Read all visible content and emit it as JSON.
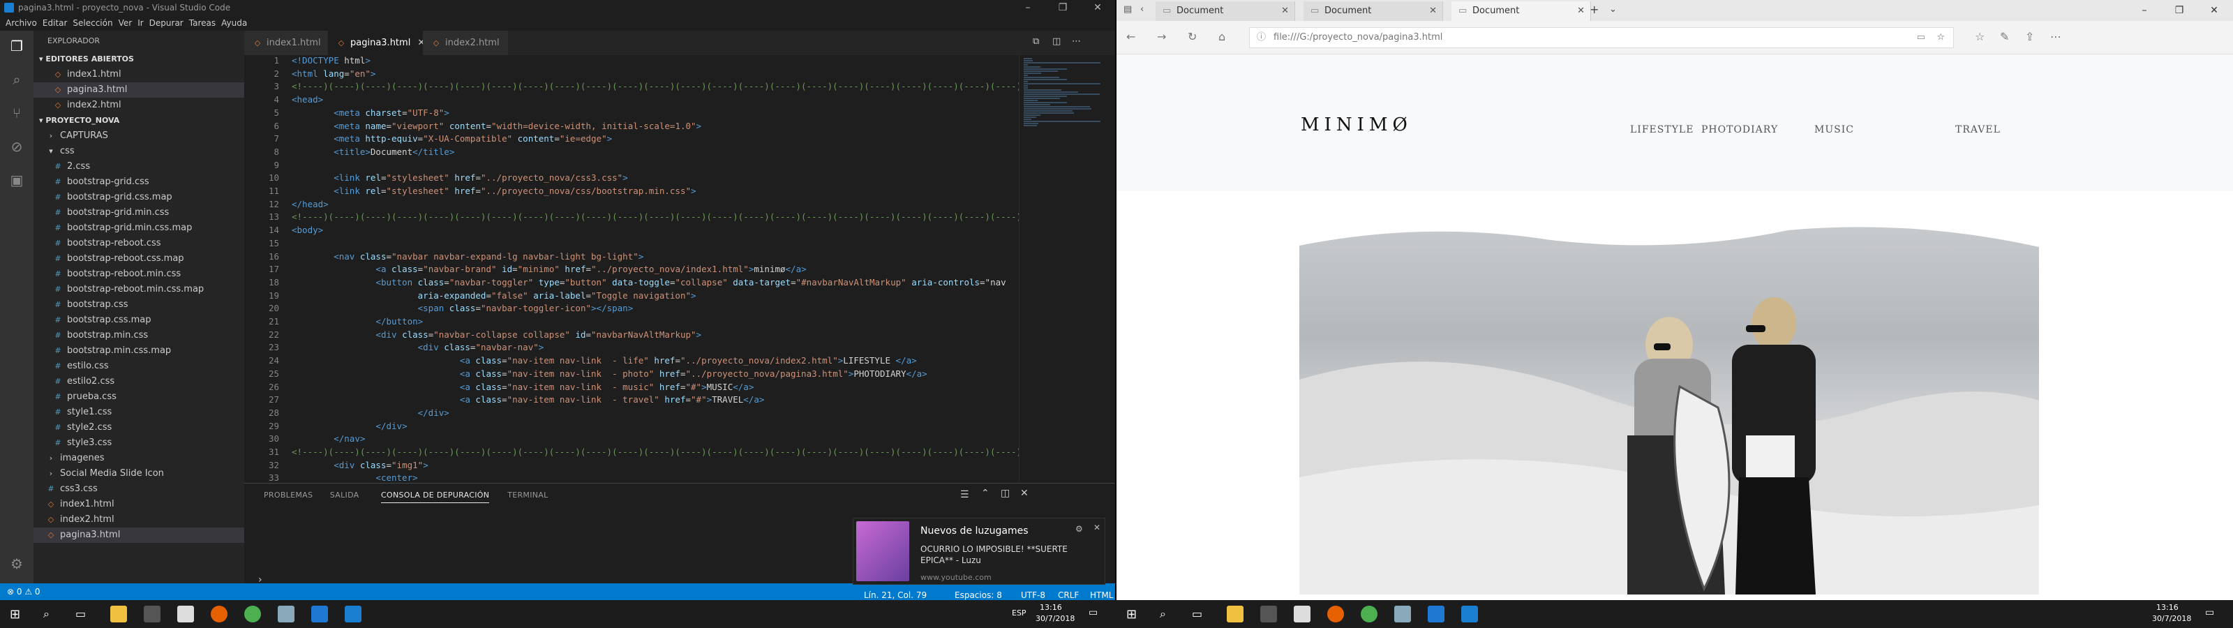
{
  "vscode": {
    "title": "pagina3.html - proyecto_nova - Visual Studio Code",
    "menu": [
      "Archivo",
      "Editar",
      "Selección",
      "Ver",
      "Ir",
      "Depurar",
      "Tareas",
      "Ayuda"
    ],
    "explorer_title": "EXPLORADOR",
    "open_editors_label": "EDITORES ABIERTOS",
    "open_editors": [
      "index1.html",
      "pagina3.html",
      "index2.html"
    ],
    "project_label": "PROYECTO_NOVA",
    "tree": [
      {
        "name": "CAPTURAS",
        "kind": "dir",
        "indent": 1,
        "open": false
      },
      {
        "name": "css",
        "kind": "dir",
        "indent": 1,
        "open": true
      },
      {
        "name": "2.css",
        "kind": "css",
        "indent": 2
      },
      {
        "name": "bootstrap-grid.css",
        "kind": "css",
        "indent": 2
      },
      {
        "name": "bootstrap-grid.css.map",
        "kind": "css",
        "indent": 2
      },
      {
        "name": "bootstrap-grid.min.css",
        "kind": "css",
        "indent": 2
      },
      {
        "name": "bootstrap-grid.min.css.map",
        "kind": "css",
        "indent": 2
      },
      {
        "name": "bootstrap-reboot.css",
        "kind": "css",
        "indent": 2
      },
      {
        "name": "bootstrap-reboot.css.map",
        "kind": "css",
        "indent": 2
      },
      {
        "name": "bootstrap-reboot.min.css",
        "kind": "css",
        "indent": 2
      },
      {
        "name": "bootstrap-reboot.min.css.map",
        "kind": "css",
        "indent": 2
      },
      {
        "name": "bootstrap.css",
        "kind": "css",
        "indent": 2
      },
      {
        "name": "bootstrap.css.map",
        "kind": "css",
        "indent": 2
      },
      {
        "name": "bootstrap.min.css",
        "kind": "css",
        "indent": 2
      },
      {
        "name": "bootstrap.min.css.map",
        "kind": "css",
        "indent": 2
      },
      {
        "name": "estilo.css",
        "kind": "css",
        "indent": 2
      },
      {
        "name": "estilo2.css",
        "kind": "css",
        "indent": 2
      },
      {
        "name": "prueba.css",
        "kind": "css",
        "indent": 2
      },
      {
        "name": "style1.css",
        "kind": "css",
        "indent": 2
      },
      {
        "name": "style2.css",
        "kind": "css",
        "indent": 2
      },
      {
        "name": "style3.css",
        "kind": "css",
        "indent": 2
      },
      {
        "name": "imagenes",
        "kind": "dir",
        "indent": 1,
        "open": false
      },
      {
        "name": "Social Media Slide Icon",
        "kind": "dir",
        "indent": 1,
        "open": false
      },
      {
        "name": "css3.css",
        "kind": "css",
        "indent": 1
      },
      {
        "name": "index1.html",
        "kind": "html",
        "indent": 1
      },
      {
        "name": "index2.html",
        "kind": "html",
        "indent": 1
      },
      {
        "name": "pagina3.html",
        "kind": "html",
        "indent": 1,
        "selected": true
      }
    ],
    "tabs": [
      "index1.html",
      "pagina3.html",
      "index2.html"
    ],
    "active_tab": "pagina3.html",
    "code_lines": [
      "<!DOCTYPE html>",
      "<html lang=\"en\">",
      "<!----)(----)(----)(----)(----)(----)(----)(----)(----)(----)(----)(----)(----)(----)(----)(----)(----)(----)(----)(----)(----)(----)(----)(----)(----)(----)(",
      "<head>",
      "        <meta charset=\"UTF-8\">",
      "        <meta name=\"viewport\" content=\"width=device-width, initial-scale=1.0\">",
      "        <meta http-equiv=\"X-UA-Compatible\" content=\"ie=edge\">",
      "        <title>Document</title>",
      "",
      "        <link rel=\"stylesheet\" href=\"../proyecto_nova/css3.css\">",
      "        <link rel=\"stylesheet\" href=\"../proyecto_nova/css/bootstrap.min.css\">",
      "</head>",
      "<!----)(----)(----)(----)(----)(----)(----)(----)(----)(----)(----)(----)(----)(----)(----)(----)(----)(----)(----)(----)(----)(----)(----)(----)(----)(----)(",
      "<body>",
      "",
      "        <nav class=\"navbar navbar-expand-lg navbar-light bg-light\">",
      "                <a class=\"navbar-brand\" id=\"minimo\" href=\"../proyecto_nova/index1.html\">minimø</a>",
      "                <button class=\"navbar-toggler\" type=\"button\" data-toggle=\"collapse\" data-target=\"#navbarNavAltMarkup\" aria-controls=\"nav",
      "                        aria-expanded=\"false\" aria-label=\"Toggle navigation\">",
      "                        <span class=\"navbar-toggler-icon\"></span>",
      "                </button>",
      "                <div class=\"navbar-collapse collapse\" id=\"navbarNavAltMarkup\">",
      "                        <div class=\"navbar-nav\">",
      "                                <a class=\"nav-item nav-link  - life\" href=\"../proyecto_nova/index2.html\">LIFESTYLE </a>",
      "                                <a class=\"nav-item nav-link  - photo\" href=\"../proyecto_nova/pagina3.html\">PHOTODIARY</a>",
      "                                <a class=\"nav-item nav-link  - music\" href=\"#\">MUSIC</a>",
      "                                <a class=\"nav-item nav-link  - travel\" href=\"#\">TRAVEL</a>",
      "                        </div>",
      "                </div>",
      "        </nav>",
      "<!----)(----)(----)(----)(----)(----)(----)(----)(----)(----)(----)(----)(----)(----)(----)(----)(----)(----)(----)(----)(----)(----)(----)(----)(----)(----)(",
      "        <div class=\"img1\">",
      "                <center>"
    ],
    "panel_tabs": [
      "PROBLEMAS",
      "SALIDA",
      "CONSOLA DE DEPURACIÓN",
      "TERMINAL"
    ],
    "panel_active": "CONSOLA DE DEPURACIÓN",
    "status_left": "⊗ 0  ⚠ 0",
    "status_right": [
      "Lín. 21, Col. 79",
      "Espacios: 8",
      "UTF-8",
      "CRLF",
      "HTML"
    ]
  },
  "notification": {
    "title": "Nuevos de luzugames",
    "body": "OCURRIO LO IMPOSIBLE! **SUERTE EPICA** - Luzu",
    "source": "www.youtube.com"
  },
  "edge": {
    "tabs": [
      "Document",
      "Document",
      "Document"
    ],
    "url": "file:///G:/proyecto_nova/pagina3.html",
    "site": {
      "brand": "MINIMØ",
      "nav": [
        "LIFESTYLE",
        "PHOTODIARY",
        "MUSIC",
        "TRAVEL"
      ]
    }
  },
  "taskbar": {
    "time": "13:16",
    "date": "30/7/2018",
    "lang": "ESP"
  }
}
